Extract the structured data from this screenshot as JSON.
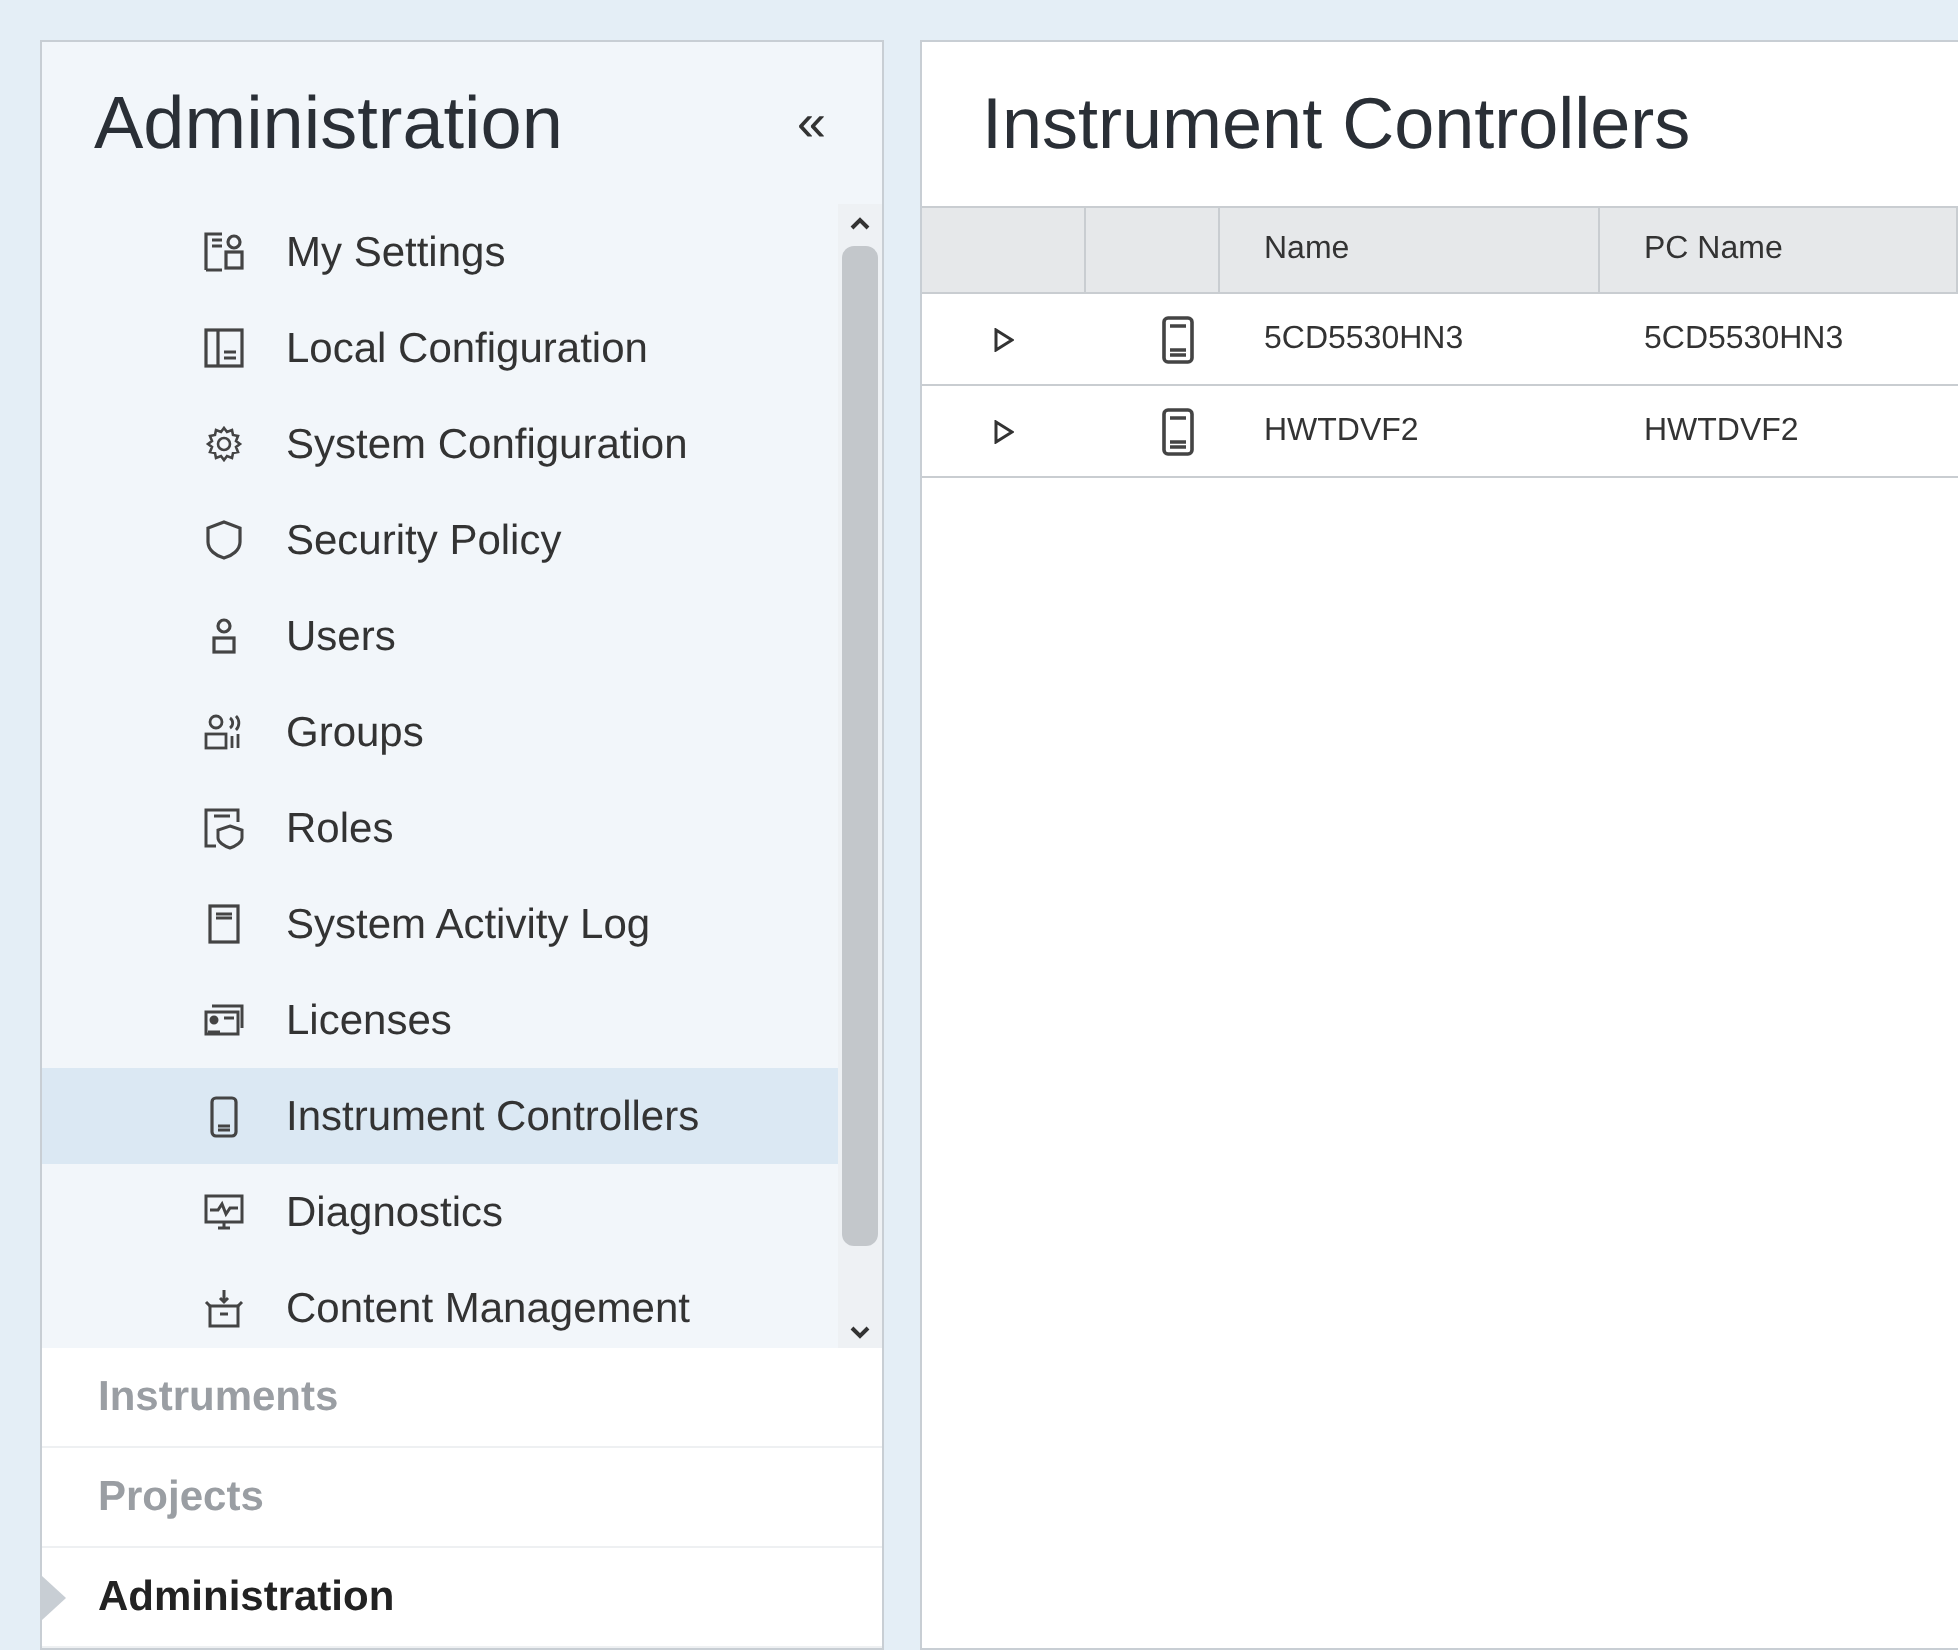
{
  "sidebar": {
    "title": "Administration",
    "collapse_glyph": "«",
    "items": [
      {
        "label": "My Settings",
        "selected": false
      },
      {
        "label": "Local Configuration",
        "selected": false
      },
      {
        "label": "System Configuration",
        "selected": false
      },
      {
        "label": "Security Policy",
        "selected": false
      },
      {
        "label": "Users",
        "selected": false
      },
      {
        "label": "Groups",
        "selected": false
      },
      {
        "label": "Roles",
        "selected": false
      },
      {
        "label": "System Activity Log",
        "selected": false
      },
      {
        "label": "Licenses",
        "selected": false
      },
      {
        "label": "Instrument Controllers",
        "selected": true
      },
      {
        "label": "Diagnostics",
        "selected": false
      },
      {
        "label": "Content Management",
        "selected": false
      }
    ],
    "sections": [
      {
        "label": "Instruments",
        "selected": false
      },
      {
        "label": "Projects",
        "selected": false
      },
      {
        "label": "Administration",
        "selected": true
      }
    ]
  },
  "main": {
    "title": "Instrument Controllers",
    "table": {
      "columns": [
        "Name",
        "PC Name"
      ],
      "rows": [
        {
          "name": "5CD5530HN3",
          "pc_name": "5CD5530HN3",
          "expanded": false
        },
        {
          "name": "HWTDVF2",
          "pc_name": "HWTDVF2",
          "expanded": false
        }
      ]
    }
  }
}
